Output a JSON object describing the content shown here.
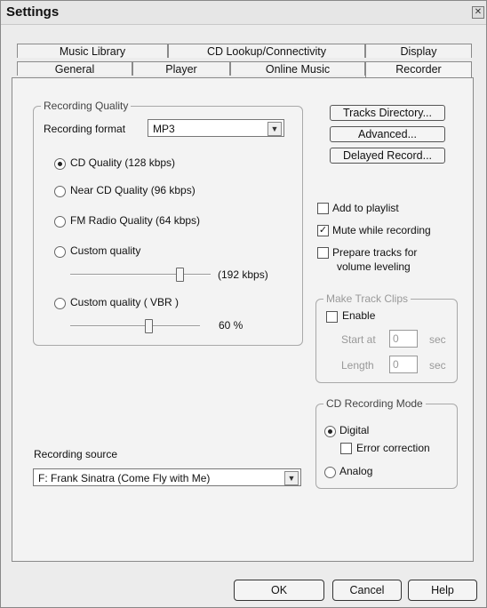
{
  "window": {
    "title": "Settings"
  },
  "tabs": {
    "row1": [
      "Music Library",
      "CD Lookup/Connectivity",
      "Display"
    ],
    "row2": [
      "General",
      "Player",
      "Online Music",
      "Recorder"
    ]
  },
  "recording_quality": {
    "title": "Recording Quality",
    "format_label": "Recording format",
    "format_value": "MP3",
    "options": [
      "CD Quality (128 kbps)",
      "Near CD Quality (96 kbps)",
      "FM Radio Quality (64 kbps)",
      "Custom quality",
      "Custom quality ( VBR )"
    ],
    "selected_index": 0,
    "custom_bitrate": "(192 kbps)",
    "custom_level": 0.78,
    "vbr_value": "60 %",
    "vbr_level": 0.6
  },
  "buttons": {
    "tracks_directory": "Tracks Directory...",
    "advanced": "Advanced...",
    "delayed_record": "Delayed Record..."
  },
  "checks": {
    "add_to_playlist": {
      "label": "Add to playlist",
      "checked": false
    },
    "mute_while_recording": {
      "label": "Mute while recording",
      "checked": true
    },
    "prepare_tracks": {
      "label1": "Prepare tracks for",
      "label2": "volume leveling",
      "checked": false
    }
  },
  "track_clips": {
    "title": "Make Track Clips",
    "enable": "Enable",
    "start_label": "Start at",
    "start_value": "0",
    "length_label": "Length",
    "length_value": "0",
    "unit": "sec"
  },
  "cd_mode": {
    "title": "CD Recording Mode",
    "digital": "Digital",
    "error_correction": "Error correction",
    "analog": "Analog"
  },
  "source": {
    "label": "Recording source",
    "value": "F: Frank Sinatra (Come Fly with Me)"
  },
  "footer": {
    "ok": "OK",
    "cancel": "Cancel",
    "help": "Help"
  }
}
